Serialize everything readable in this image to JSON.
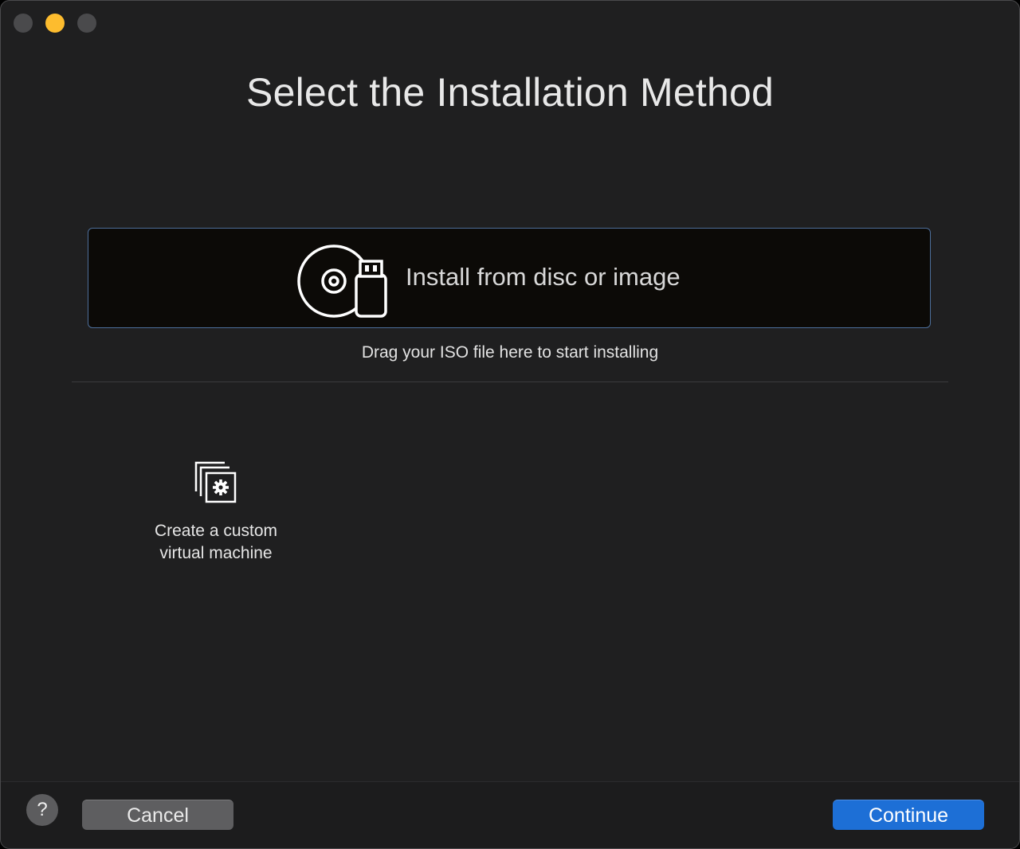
{
  "window": {
    "title": "Select the Installation Method"
  },
  "install_option": {
    "label": "Install from disc or image",
    "icon": "disc-usb-icon",
    "hint": "Drag your ISO file here to start installing"
  },
  "custom_option": {
    "icon": "custom-vm-gear-icon",
    "label_line1": "Create a custom",
    "label_line2": "virtual machine"
  },
  "footer": {
    "help_label": "?",
    "cancel_label": "Cancel",
    "continue_label": "Continue"
  },
  "colors": {
    "accent": "#1d6fd6",
    "drop_border": "#4d6e9a",
    "minimize": "#fdbc2e"
  }
}
